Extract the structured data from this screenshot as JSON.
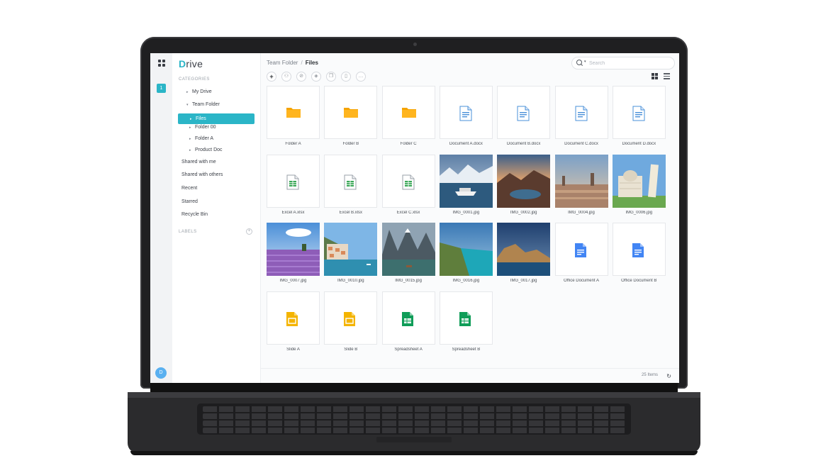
{
  "app": {
    "logo_first": "D",
    "logo_rest": "rive"
  },
  "rail": {
    "badge": "1",
    "avatar": "D"
  },
  "sidebar": {
    "categories_heading": "CATEGORIES",
    "items": [
      {
        "label": "My Drive",
        "indent": 1,
        "caret": "▸",
        "active": false
      },
      {
        "label": "Team Folder",
        "indent": 1,
        "caret": "▾",
        "active": false
      },
      {
        "label": "Files",
        "indent": 2,
        "caret": "▸",
        "active": true
      },
      {
        "label": "Folder 00",
        "indent": 2,
        "caret": "▸",
        "active": false
      },
      {
        "label": "Folder A",
        "indent": 2,
        "caret": "▸",
        "active": false
      },
      {
        "label": "Product Doc",
        "indent": 2,
        "caret": "▸",
        "active": false
      },
      {
        "label": "Shared with me",
        "indent": 0,
        "caret": "",
        "active": false
      },
      {
        "label": "Shared with others",
        "indent": 0,
        "caret": "",
        "active": false
      },
      {
        "label": "Recent",
        "indent": 0,
        "caret": "",
        "active": false
      },
      {
        "label": "Starred",
        "indent": 0,
        "caret": "",
        "active": false
      },
      {
        "label": "Recycle Bin",
        "indent": 0,
        "caret": "",
        "active": false
      }
    ],
    "labels_heading": "LABELS",
    "labels_add": "+"
  },
  "breadcrumb": {
    "parent": "Team Folder",
    "separator": "/",
    "current": "Files"
  },
  "search": {
    "placeholder": "Search",
    "value": ""
  },
  "toolbar": {
    "buttons": [
      {
        "name": "new-button",
        "icon": "+"
      },
      {
        "name": "share-user-button",
        "icon": "⚇"
      },
      {
        "name": "link-button",
        "icon": "⊘"
      },
      {
        "name": "tag-button",
        "icon": "◈"
      },
      {
        "name": "copy-button",
        "icon": "❐"
      },
      {
        "name": "delete-button",
        "icon": "▯"
      },
      {
        "name": "more-button",
        "icon": "…"
      }
    ]
  },
  "files": [
    {
      "name": "Folder A",
      "kind": "folder"
    },
    {
      "name": "Folder B",
      "kind": "folder"
    },
    {
      "name": "Folder C",
      "kind": "folder"
    },
    {
      "name": "Document A.docx",
      "kind": "doc"
    },
    {
      "name": "Document B.docx",
      "kind": "doc"
    },
    {
      "name": "Document C.docx",
      "kind": "doc"
    },
    {
      "name": "Document D.docx",
      "kind": "doc"
    },
    {
      "name": "Excel A.xlsx",
      "kind": "xlsx"
    },
    {
      "name": "Excel B.xlsx",
      "kind": "xlsx"
    },
    {
      "name": "Excel C.xlsx",
      "kind": "xlsx"
    },
    {
      "name": "IMG_0001.jpg",
      "kind": "photo",
      "scene": "cruise"
    },
    {
      "name": "IMG_0002.jpg",
      "kind": "photo",
      "scene": "lake-sunset"
    },
    {
      "name": "IMG_0004.jpg",
      "kind": "photo",
      "scene": "city"
    },
    {
      "name": "IMG_0006.jpg",
      "kind": "photo",
      "scene": "pisa"
    },
    {
      "name": "IMG_0007.jpg",
      "kind": "photo",
      "scene": "lavender"
    },
    {
      "name": "IMG_0010.jpg",
      "kind": "photo",
      "scene": "coast-town"
    },
    {
      "name": "IMG_0015.jpg",
      "kind": "photo",
      "scene": "alpine-lake"
    },
    {
      "name": "IMG_0016.jpg",
      "kind": "photo",
      "scene": "sea-cliff"
    },
    {
      "name": "IMG_0017.jpg",
      "kind": "photo",
      "scene": "island"
    },
    {
      "name": "Office Document A",
      "kind": "gdoc"
    },
    {
      "name": "Office Document B",
      "kind": "gdoc"
    },
    {
      "name": "Slide A",
      "kind": "slide"
    },
    {
      "name": "Slide B",
      "kind": "slide"
    },
    {
      "name": "Spreadsheet A",
      "kind": "sheet"
    },
    {
      "name": "Spreadsheet B",
      "kind": "sheet"
    }
  ],
  "footer": {
    "count": "25 Items",
    "refresh_icon": "↻"
  },
  "colors": {
    "accent": "#2bb5c7",
    "folder": "#f5a300",
    "doc": "#4a90d9",
    "xlsx": "#3aa757",
    "gdoc": "#4285f4",
    "slide": "#f4b400",
    "sheet": "#0f9d58"
  }
}
